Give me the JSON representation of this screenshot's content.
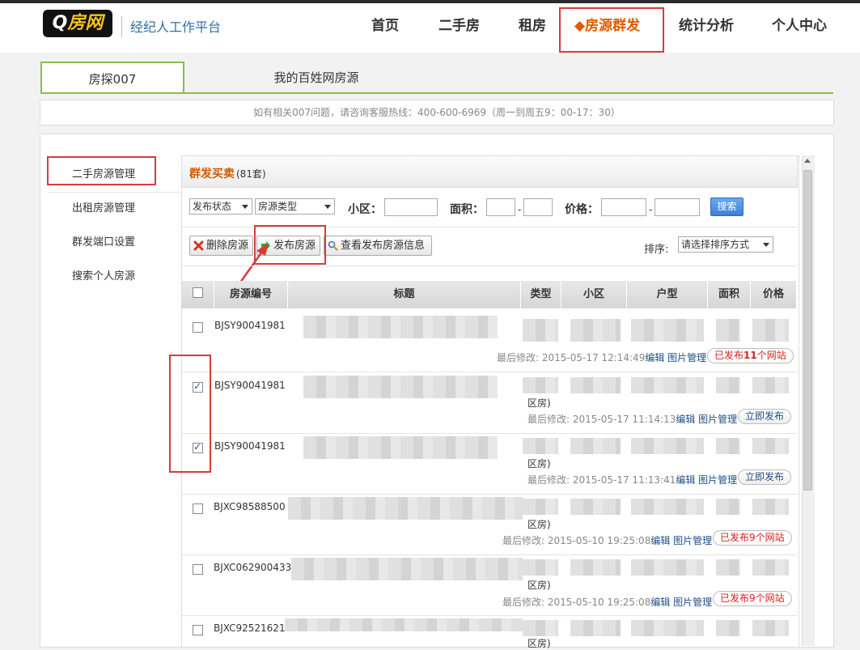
{
  "header": {
    "logo_q": "Q",
    "logo_brand": "房网",
    "subtitle": "经纪人工作平台",
    "nav": [
      "首页",
      "二手房",
      "租房",
      "◆房源群发",
      "统计分析",
      "个人中心"
    ]
  },
  "tabs": [
    "房探007",
    "我的百姓网房源"
  ],
  "notice": "如有相关007问题，请咨询客服热线：400-600-6969（周一到周五9：00-17：30）",
  "sidebar": [
    "二手房源管理",
    "出租房源管理",
    "群发端口设置",
    "搜索个人房源"
  ],
  "panel": {
    "title": "群发买卖",
    "count": "(81套)"
  },
  "filters": {
    "status_select": "发布状态",
    "type_select": "房源类型",
    "community_label": "小区：",
    "area_label": "面积：",
    "price_label": "价格：",
    "dash": "-",
    "search_button": "搜索"
  },
  "actions": {
    "delete": "删除房源",
    "publish": "发布房源",
    "view_info": "查看发布房源信息",
    "sort_label": "排序:",
    "sort_select": "请选择排序方式"
  },
  "table": {
    "headers": [
      "房源编号",
      "标题",
      "类型",
      "小区",
      "户型",
      "面积",
      "价格"
    ],
    "rows": [
      {
        "id": "BJSY90041981",
        "checked": false,
        "modified_label": "最后修改:",
        "modified": "2015-05-17 12:14:49",
        "edit": "编辑",
        "images": "图片管理",
        "status_pre": "已发布",
        "status_num": "11",
        "status_post": "个网站",
        "status_kind": "published",
        "extra": ""
      },
      {
        "id": "BJSY90041981",
        "checked": true,
        "modified_label": "最后修改:",
        "modified": "2015-05-17 11:14:13",
        "edit": "编辑",
        "images": "图片管理",
        "status_pre": "立即发布",
        "status_num": "",
        "status_post": "",
        "status_kind": "pub-now",
        "extra": "区房)"
      },
      {
        "id": "BJSY90041981",
        "checked": true,
        "modified_label": "最后修改:",
        "modified": "2015-05-17 11:13:41",
        "edit": "编辑",
        "images": "图片管理",
        "status_pre": "立即发布",
        "status_num": "",
        "status_post": "",
        "status_kind": "pub-now",
        "extra": "区房)"
      },
      {
        "id": "BJXC98588500",
        "checked": false,
        "modified_label": "最后修改:",
        "modified": "2015-05-10 19:25:08",
        "edit": "编辑",
        "images": "图片管理",
        "status_pre": "已发布",
        "status_num": "9",
        "status_post": "个网站",
        "status_kind": "published",
        "extra": "区房)"
      },
      {
        "id": "BJXC062900433",
        "checked": false,
        "modified_label": "最后修改:",
        "modified": "2015-05-10 19:25:08",
        "edit": "编辑",
        "images": "图片管理",
        "status_pre": "已发布",
        "status_num": "9",
        "status_post": "个网站",
        "status_kind": "published",
        "extra": "区房)"
      },
      {
        "id": "BJXC92521621",
        "checked": false,
        "modified_label": "",
        "modified": "",
        "edit": "",
        "images": "",
        "status_pre": "",
        "status_num": "",
        "status_post": "",
        "status_kind": "",
        "extra": "区房)"
      }
    ]
  },
  "colors": {
    "accent": "#e05a00",
    "highlight": "#d83b3b",
    "tab_green": "#8bbd4c",
    "link": "#1f4f86"
  }
}
